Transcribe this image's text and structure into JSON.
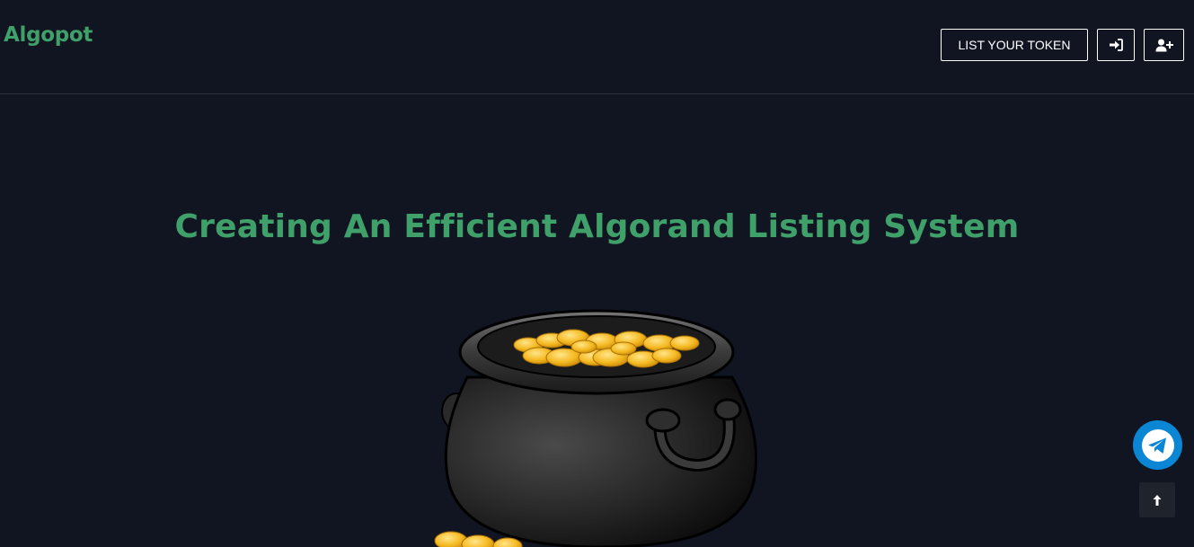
{
  "header": {
    "logo": "Algopot",
    "list_token_label": "LIST YOUR TOKEN",
    "login_icon": "sign-in-icon",
    "register_icon": "user-plus-icon"
  },
  "hero": {
    "title": "Creating An Efficient Algorand Listing System",
    "image": "pot-of-gold-coins"
  },
  "floating": {
    "telegram_icon": "telegram-icon",
    "back_to_top_icon": "arrow-up-icon"
  },
  "colors": {
    "background": "#111522",
    "accent_green": "#3fa06a",
    "telegram_blue": "#0b86d4"
  }
}
